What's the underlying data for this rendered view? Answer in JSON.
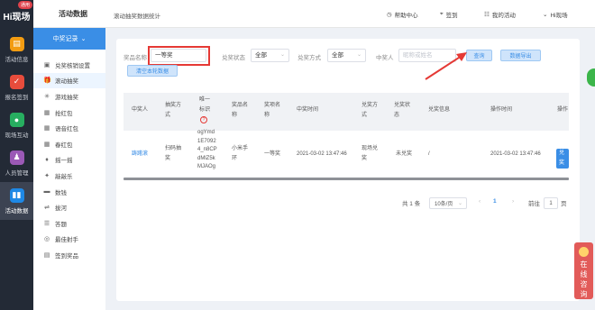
{
  "app": {
    "logo": "Hi现场",
    "badge": "通用"
  },
  "rail": [
    {
      "label": "活动信息",
      "icon": "document-icon",
      "color": "#f39c12",
      "glyph": "▤"
    },
    {
      "label": "报名签到",
      "icon": "calendar-check-icon",
      "color": "#e74c3c",
      "glyph": "✓"
    },
    {
      "label": "现场互动",
      "icon": "chat-icon",
      "color": "#27ae60",
      "glyph": "●"
    },
    {
      "label": "人员管理",
      "icon": "person-icon",
      "color": "#9b59b6",
      "glyph": "♟"
    },
    {
      "label": "活动数据",
      "icon": "bar-chart-icon",
      "color": "#1e88e5",
      "glyph": "▮▮"
    }
  ],
  "topbar": {
    "module_title": "活动数据",
    "breadcrumb": "滚动抽奖数据统计",
    "help": "帮助中心",
    "signin": "签到",
    "my_activity": "我的活动",
    "user": "Hi现场"
  },
  "sidebar": {
    "header": "中奖记录",
    "items": [
      {
        "label": "兑奖核销设置",
        "icon": "card-icon",
        "glyph": "▣"
      },
      {
        "label": "滚动抽奖",
        "icon": "gift-icon",
        "glyph": "🎁",
        "active": true
      },
      {
        "label": "游戏抽奖",
        "icon": "snowflake-icon",
        "glyph": "✳"
      },
      {
        "label": "抢红包",
        "icon": "red-envelope-icon",
        "glyph": "▦"
      },
      {
        "label": "语音红包",
        "icon": "voice-envelope-icon",
        "glyph": "▦"
      },
      {
        "label": "春红包",
        "icon": "spring-envelope-icon",
        "glyph": "▦"
      },
      {
        "label": "摇一摇",
        "icon": "shake-icon",
        "glyph": "♦"
      },
      {
        "label": "敲敲乐",
        "icon": "hammer-icon",
        "glyph": "✦"
      },
      {
        "label": "数钱",
        "icon": "money-icon",
        "glyph": "▬"
      },
      {
        "label": "拔河",
        "icon": "tug-icon",
        "glyph": "⇌"
      },
      {
        "label": "答题",
        "icon": "question-icon",
        "glyph": "☰"
      },
      {
        "label": "最佳射手",
        "icon": "target-icon",
        "glyph": "◎"
      },
      {
        "label": "签到奖品",
        "icon": "prize-icon",
        "glyph": "▤"
      }
    ]
  },
  "filters": {
    "prize_name_label": "奖品名称",
    "prize_name_value": "一等奖",
    "status_label": "兑奖状态",
    "status_value": "全部",
    "method_label": "兑奖方式",
    "method_value": "全部",
    "winner_label": "中奖人",
    "winner_placeholder": "昵称或姓名",
    "search_button": "查询",
    "export_button": "数据导出",
    "clear_button": "清空本轮数据"
  },
  "table": {
    "headers": [
      "中奖人",
      "抽奖方式",
      "唯一标识",
      "奖品名称",
      "奖项名称",
      "中奖时间",
      "兑奖方式",
      "兑奖状态",
      "兑奖信息",
      "操作时间",
      "操作"
    ],
    "rows": [
      {
        "winner": "踌躇滚",
        "method": "扫码抽奖",
        "uid": "ogYmd1E70924_n8CPdMlZ5kMJAOg",
        "prize": "小米手环",
        "award": "一等奖",
        "win_time": "2021-03-02 13:47:46",
        "redeem_method": "现场兑奖",
        "redeem_status": "未兑奖",
        "redeem_info": "/",
        "op_time": "2021-03-02 13:47:46",
        "action": "兑奖"
      }
    ]
  },
  "pagination": {
    "total": "共 1 条",
    "page_size": "10条/页",
    "current": "1",
    "goto_label": "前往",
    "goto_value": "1",
    "page_unit": "页"
  },
  "float_help": [
    "在",
    "线",
    "咨",
    "询"
  ]
}
